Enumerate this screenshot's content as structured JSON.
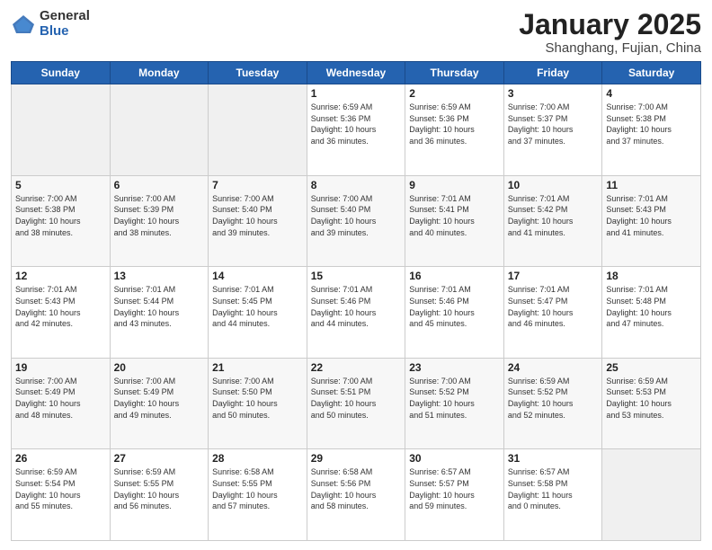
{
  "logo": {
    "general": "General",
    "blue": "Blue"
  },
  "header": {
    "month": "January 2025",
    "location": "Shanghang, Fujian, China"
  },
  "days_of_week": [
    "Sunday",
    "Monday",
    "Tuesday",
    "Wednesday",
    "Thursday",
    "Friday",
    "Saturday"
  ],
  "weeks": [
    [
      {
        "day": "",
        "info": ""
      },
      {
        "day": "",
        "info": ""
      },
      {
        "day": "",
        "info": ""
      },
      {
        "day": "1",
        "info": "Sunrise: 6:59 AM\nSunset: 5:36 PM\nDaylight: 10 hours\nand 36 minutes."
      },
      {
        "day": "2",
        "info": "Sunrise: 6:59 AM\nSunset: 5:36 PM\nDaylight: 10 hours\nand 36 minutes."
      },
      {
        "day": "3",
        "info": "Sunrise: 7:00 AM\nSunset: 5:37 PM\nDaylight: 10 hours\nand 37 minutes."
      },
      {
        "day": "4",
        "info": "Sunrise: 7:00 AM\nSunset: 5:38 PM\nDaylight: 10 hours\nand 37 minutes."
      }
    ],
    [
      {
        "day": "5",
        "info": "Sunrise: 7:00 AM\nSunset: 5:38 PM\nDaylight: 10 hours\nand 38 minutes."
      },
      {
        "day": "6",
        "info": "Sunrise: 7:00 AM\nSunset: 5:39 PM\nDaylight: 10 hours\nand 38 minutes."
      },
      {
        "day": "7",
        "info": "Sunrise: 7:00 AM\nSunset: 5:40 PM\nDaylight: 10 hours\nand 39 minutes."
      },
      {
        "day": "8",
        "info": "Sunrise: 7:00 AM\nSunset: 5:40 PM\nDaylight: 10 hours\nand 39 minutes."
      },
      {
        "day": "9",
        "info": "Sunrise: 7:01 AM\nSunset: 5:41 PM\nDaylight: 10 hours\nand 40 minutes."
      },
      {
        "day": "10",
        "info": "Sunrise: 7:01 AM\nSunset: 5:42 PM\nDaylight: 10 hours\nand 41 minutes."
      },
      {
        "day": "11",
        "info": "Sunrise: 7:01 AM\nSunset: 5:43 PM\nDaylight: 10 hours\nand 41 minutes."
      }
    ],
    [
      {
        "day": "12",
        "info": "Sunrise: 7:01 AM\nSunset: 5:43 PM\nDaylight: 10 hours\nand 42 minutes."
      },
      {
        "day": "13",
        "info": "Sunrise: 7:01 AM\nSunset: 5:44 PM\nDaylight: 10 hours\nand 43 minutes."
      },
      {
        "day": "14",
        "info": "Sunrise: 7:01 AM\nSunset: 5:45 PM\nDaylight: 10 hours\nand 44 minutes."
      },
      {
        "day": "15",
        "info": "Sunrise: 7:01 AM\nSunset: 5:46 PM\nDaylight: 10 hours\nand 44 minutes."
      },
      {
        "day": "16",
        "info": "Sunrise: 7:01 AM\nSunset: 5:46 PM\nDaylight: 10 hours\nand 45 minutes."
      },
      {
        "day": "17",
        "info": "Sunrise: 7:01 AM\nSunset: 5:47 PM\nDaylight: 10 hours\nand 46 minutes."
      },
      {
        "day": "18",
        "info": "Sunrise: 7:01 AM\nSunset: 5:48 PM\nDaylight: 10 hours\nand 47 minutes."
      }
    ],
    [
      {
        "day": "19",
        "info": "Sunrise: 7:00 AM\nSunset: 5:49 PM\nDaylight: 10 hours\nand 48 minutes."
      },
      {
        "day": "20",
        "info": "Sunrise: 7:00 AM\nSunset: 5:49 PM\nDaylight: 10 hours\nand 49 minutes."
      },
      {
        "day": "21",
        "info": "Sunrise: 7:00 AM\nSunset: 5:50 PM\nDaylight: 10 hours\nand 50 minutes."
      },
      {
        "day": "22",
        "info": "Sunrise: 7:00 AM\nSunset: 5:51 PM\nDaylight: 10 hours\nand 50 minutes."
      },
      {
        "day": "23",
        "info": "Sunrise: 7:00 AM\nSunset: 5:52 PM\nDaylight: 10 hours\nand 51 minutes."
      },
      {
        "day": "24",
        "info": "Sunrise: 6:59 AM\nSunset: 5:52 PM\nDaylight: 10 hours\nand 52 minutes."
      },
      {
        "day": "25",
        "info": "Sunrise: 6:59 AM\nSunset: 5:53 PM\nDaylight: 10 hours\nand 53 minutes."
      }
    ],
    [
      {
        "day": "26",
        "info": "Sunrise: 6:59 AM\nSunset: 5:54 PM\nDaylight: 10 hours\nand 55 minutes."
      },
      {
        "day": "27",
        "info": "Sunrise: 6:59 AM\nSunset: 5:55 PM\nDaylight: 10 hours\nand 56 minutes."
      },
      {
        "day": "28",
        "info": "Sunrise: 6:58 AM\nSunset: 5:55 PM\nDaylight: 10 hours\nand 57 minutes."
      },
      {
        "day": "29",
        "info": "Sunrise: 6:58 AM\nSunset: 5:56 PM\nDaylight: 10 hours\nand 58 minutes."
      },
      {
        "day": "30",
        "info": "Sunrise: 6:57 AM\nSunset: 5:57 PM\nDaylight: 10 hours\nand 59 minutes."
      },
      {
        "day": "31",
        "info": "Sunrise: 6:57 AM\nSunset: 5:58 PM\nDaylight: 11 hours\nand 0 minutes."
      },
      {
        "day": "",
        "info": ""
      }
    ]
  ]
}
